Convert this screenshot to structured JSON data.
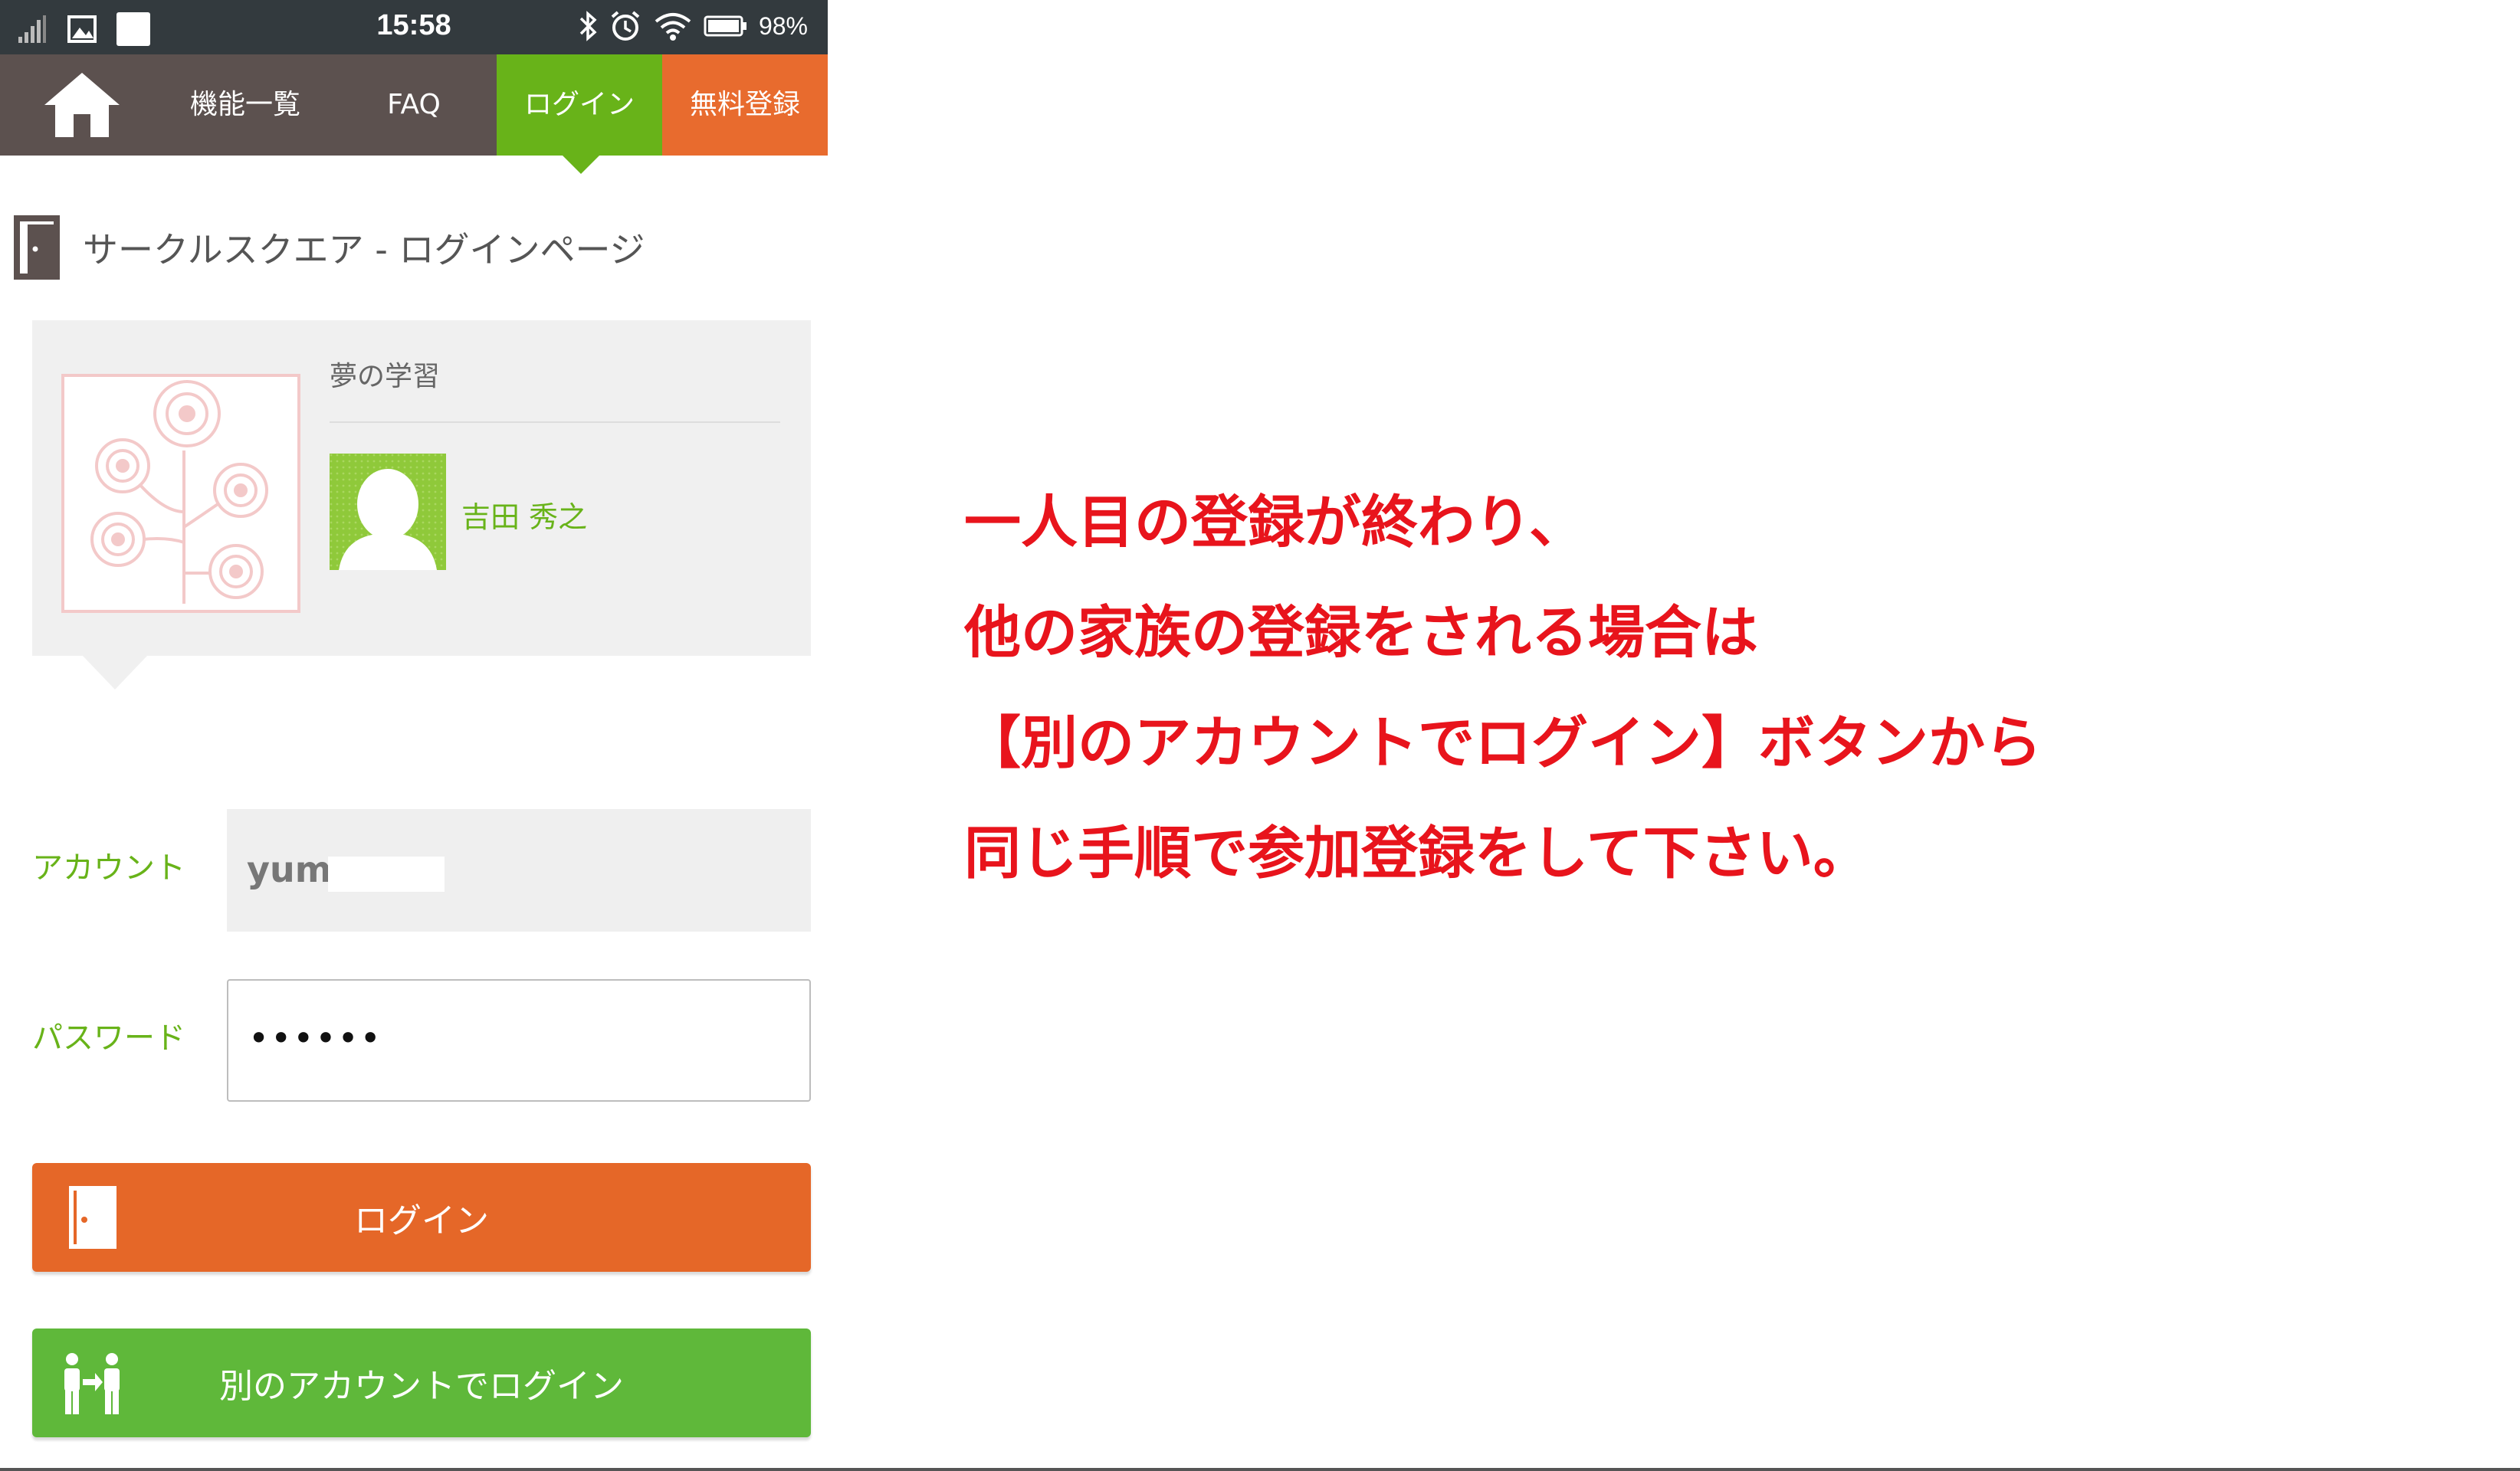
{
  "status_bar": {
    "time": "15:58",
    "battery": "98%",
    "icons_left": [
      "signal-icon",
      "image-icon",
      "square-icon"
    ],
    "icons_right": [
      "bluetooth-icon",
      "alarm-icon",
      "wifi-icon",
      "battery-icon"
    ]
  },
  "nav": {
    "home_icon": "home-icon",
    "items": [
      {
        "label": "機能一覧"
      },
      {
        "label": "FAQ"
      },
      {
        "label": "ログイン",
        "active": true
      },
      {
        "label": "無料登録"
      }
    ],
    "colors": {
      "bar": "#5c514f",
      "active": "#68b319",
      "register": "#e86b2e"
    }
  },
  "page": {
    "title": "サークルスクエア - ログインページ",
    "title_icon": "door-icon"
  },
  "circle_card": {
    "name": "夢の学習",
    "member_name": "吉田 秀之",
    "logo_icon": "circle-tree-logo",
    "avatar_icon": "avatar-placeholder"
  },
  "form": {
    "account_label": "アカウント",
    "account_value": "yum",
    "password_label": "パスワード",
    "password_value": "••••••"
  },
  "buttons": {
    "login": {
      "label": "ログイン",
      "icon": "door-icon",
      "color": "#e56728"
    },
    "other_account": {
      "label": "別のアカウントでログイン",
      "icon": "people-switch-icon",
      "color": "#5fb83a"
    }
  },
  "annotation": {
    "color": "#e8141c",
    "lines": [
      "一人目の登録が終わり、",
      "他の家族の登録をされる場合は",
      "【別のアカウントでログイン】ボタンから",
      "同じ手順で参加登録をして下さい。"
    ]
  }
}
